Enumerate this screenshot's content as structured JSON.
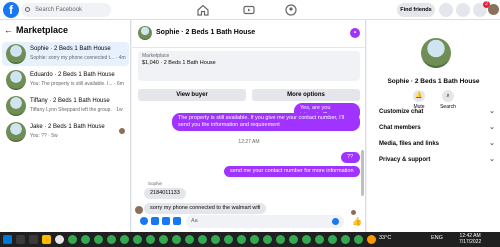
{
  "topbar": {
    "search_placeholder": "Search Facebook",
    "find_friends": "Find friends",
    "notification_badge": "2"
  },
  "left": {
    "title": "Marketplace",
    "conversations": [
      {
        "title": "Sophie · 2 Beds 1 Bath House",
        "sub": "Sophie: sorry my phone connected t... · 4m"
      },
      {
        "title": "Eduardo · 2 Beds 1 Bath House",
        "sub": "You: The property is still available. I... · 6m"
      },
      {
        "title": "Tiffany · 2 Beds 1 Bath House",
        "sub": "Tiffany Lynn Sheppard left the group. · 1w"
      },
      {
        "title": "Jake · 2 Beds 1 Bath House",
        "sub": "You: ?? · 5w"
      }
    ]
  },
  "chat": {
    "title": "Sophie · 2 Beds 1 Bath House",
    "listing_label": "Marketplace",
    "listing_price": "$1,040 · 2 Beds 1 Bath House",
    "view_buyer": "View buyer",
    "more_options": "More options",
    "messages": {
      "m1": "Yes, are you interested?",
      "m2": "The property is still available. If you give me your contact number, I'll send you the information and requirement",
      "time": "12:27 AM",
      "m3": "??",
      "m4": "send me your contact number for more information",
      "sender": "Sophie",
      "m5": "2184011133",
      "m6": "sorry my phone connected to the walmart wifi"
    },
    "input_placeholder": "Aa"
  },
  "right": {
    "title": "Sophie · 2 Beds 1 Bath House",
    "mute": "Mute",
    "search": "Search",
    "rows": [
      "Customize chat",
      "Chat members",
      "Media, files and links",
      "Privacy & support"
    ]
  },
  "taskbar": {
    "temp": "33°C",
    "lang": "ENG",
    "time": "12:42 AM",
    "date": "7/17/2022"
  },
  "colors": {
    "accent": "#a033ff",
    "facebook_blue": "#1877f2"
  }
}
